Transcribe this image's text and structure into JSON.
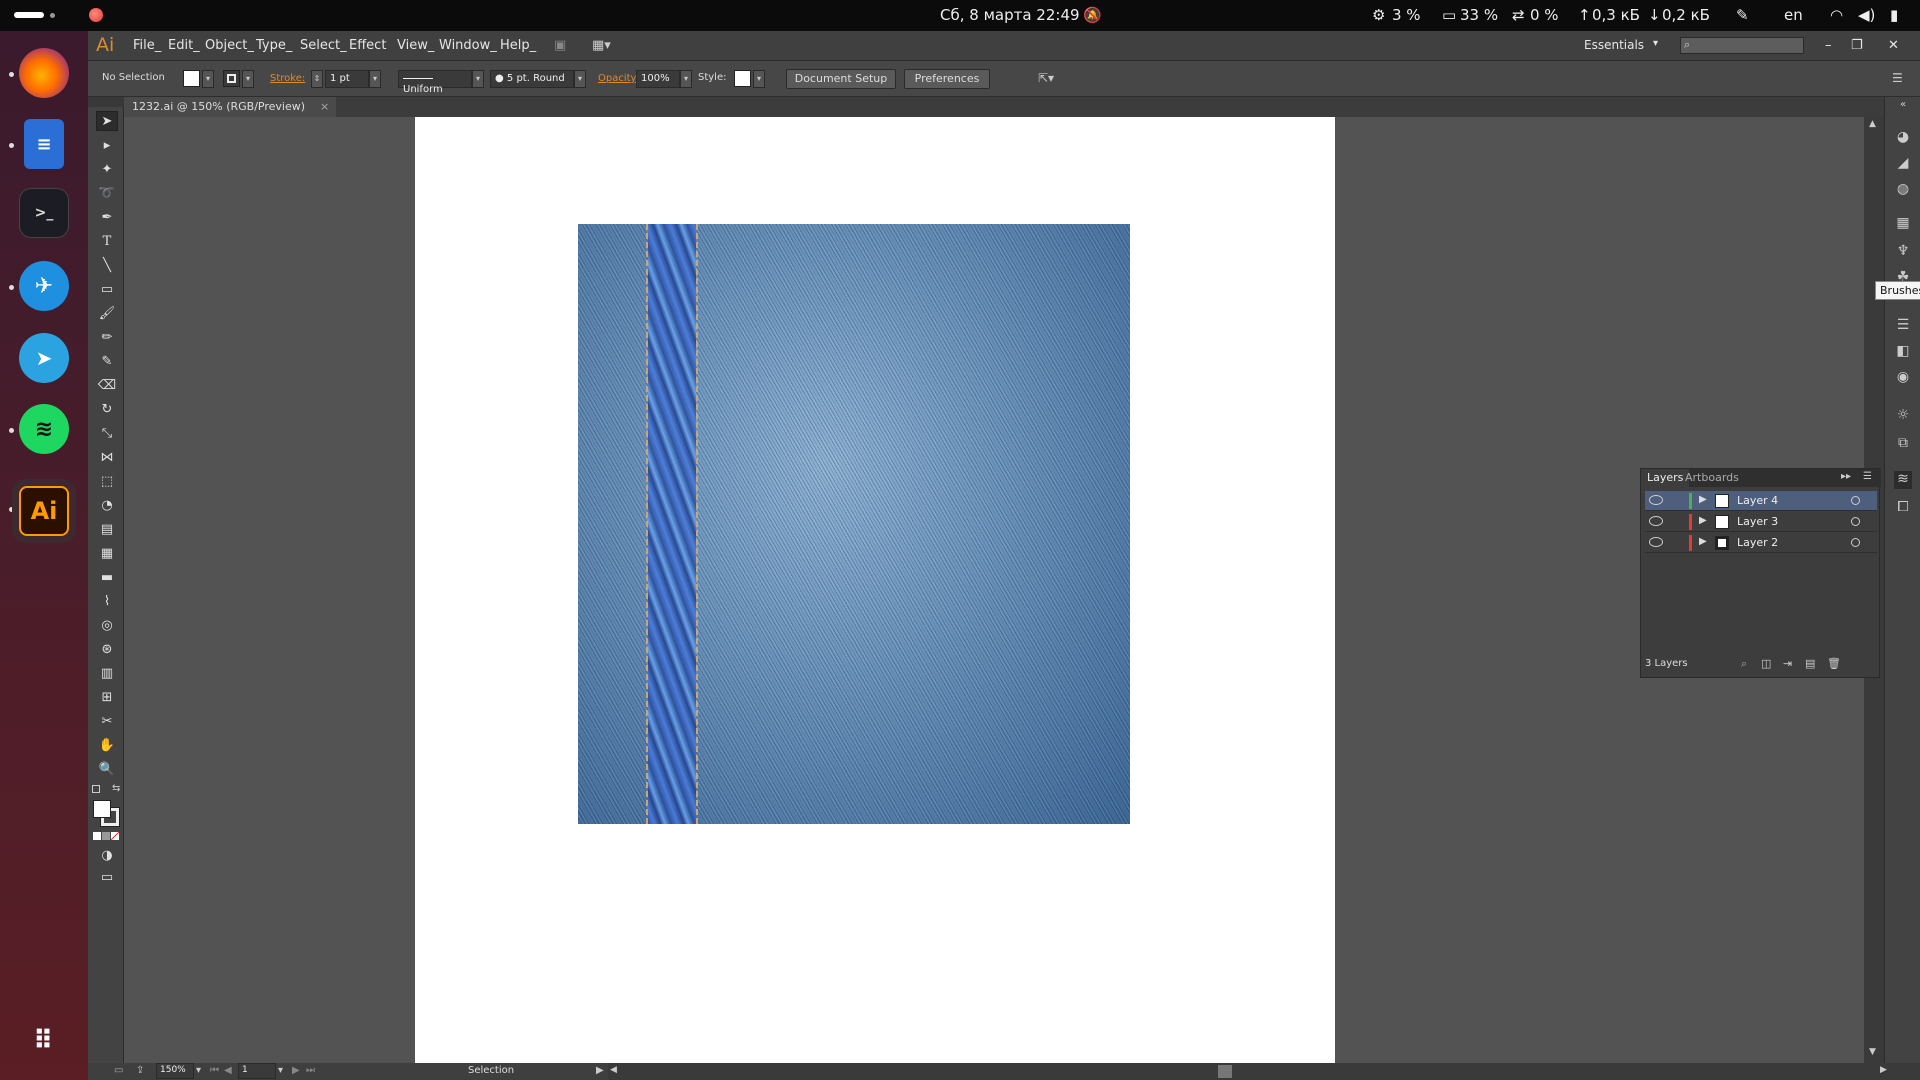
{
  "topbar": {
    "datetime": "Сб, 8 марта 22:49",
    "cpu": "3 %",
    "memory": "33 %",
    "swap": "0 %",
    "upload": "0,3 кБ",
    "download": "0,2 кБ",
    "language": "en"
  },
  "dock": {
    "apps": [
      "firefox",
      "text-editor",
      "terminal",
      "kite",
      "telegram",
      "spotify",
      "illustrator"
    ],
    "illustrator_label": "Ai"
  },
  "menubar": {
    "logo": "Ai",
    "items": [
      "File_",
      "Edit_",
      "Object_",
      "Type_",
      "Select_",
      "Effect",
      "View_",
      "Window_",
      "Help_"
    ],
    "workspace": "Essentials"
  },
  "control": {
    "selection_label": "No Selection",
    "stroke_label": "Stroke:",
    "stroke_value": "1 pt",
    "profile": "Uniform",
    "brush": "5 pt. Round",
    "opacity_label": "Opacity",
    "opacity_value": "100%",
    "style_label": "Style:",
    "document_setup": "Document Setup",
    "preferences": "Preferences"
  },
  "document": {
    "tab_title": "1232.ai @ 150% (RGB/Preview)",
    "tab_close": "×"
  },
  "tooltip": "Brushes",
  "layers_panel": {
    "tab_layers": "Layers",
    "tab_artboards": "Artboards",
    "layers": [
      {
        "name": "Layer 4",
        "color": "#4caf50",
        "selected": true
      },
      {
        "name": "Layer 3",
        "color": "#e53935",
        "selected": false
      },
      {
        "name": "Layer 2",
        "color": "#e53935",
        "selected": false
      }
    ],
    "count": "3 Layers"
  },
  "status": {
    "zoom": "150%",
    "artboard": "1",
    "tool": "Selection"
  },
  "colors": {
    "accent": "#e08a2c",
    "denim": "#6c95bd"
  }
}
